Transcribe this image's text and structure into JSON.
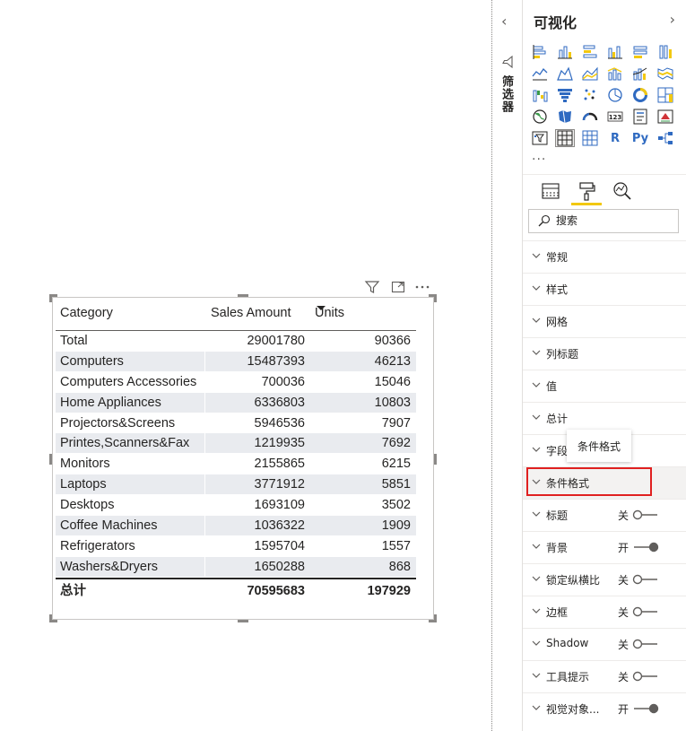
{
  "table": {
    "headers": [
      "Category",
      "Sales Amount",
      "Units"
    ],
    "rows": [
      {
        "category": "Total",
        "sales": "29001780",
        "units": "90366"
      },
      {
        "category": "Computers",
        "sales": "15487393",
        "units": "46213"
      },
      {
        "category": "Computers Accessories",
        "sales": "700036",
        "units": "15046"
      },
      {
        "category": "Home Appliances",
        "sales": "6336803",
        "units": "10803"
      },
      {
        "category": "Projectors&Screens",
        "sales": "5946536",
        "units": "7907"
      },
      {
        "category": "Printes,Scanners&Fax",
        "sales": "1219935",
        "units": "7692"
      },
      {
        "category": "Monitors",
        "sales": "2155865",
        "units": "6215"
      },
      {
        "category": "Laptops",
        "sales": "3771912",
        "units": "5851"
      },
      {
        "category": "Desktops",
        "sales": "1693109",
        "units": "3502"
      },
      {
        "category": "Coffee Machines",
        "sales": "1036322",
        "units": "1909"
      },
      {
        "category": "Refrigerators",
        "sales": "1595704",
        "units": "1557"
      },
      {
        "category": "Washers&Dryers",
        "sales": "1650288",
        "units": "868"
      }
    ],
    "total": {
      "category": "总计",
      "sales": "70595683",
      "units": "197929"
    },
    "sort_column": "Units",
    "sort_direction": "descending"
  },
  "visual_header_icons": [
    "filter-icon",
    "focus-mode-icon",
    "more-options-icon"
  ],
  "filter_pane": {
    "label": "筛选器",
    "collapse_icon": "chevron-left-icon"
  },
  "viz_pane": {
    "title": "可视化",
    "expand_icon": "chevron-right-icon",
    "more_label": "···",
    "visual_icons": [
      "stacked-bar-chart",
      "stacked-column-chart",
      "clustered-bar-chart",
      "clustered-column-chart",
      "100-stacked-bar-chart",
      "100-stacked-column-chart",
      "line-chart",
      "area-chart",
      "stacked-area-chart",
      "line-clustered-column-chart",
      "line-stacked-column-chart",
      "ribbon-chart",
      "waterfall-chart",
      "funnel-chart",
      "scatter-chart",
      "pie-chart",
      "donut-chart",
      "treemap",
      "map",
      "filled-map",
      "gauge",
      "card",
      "multi-row-card",
      "kpi",
      "slicer",
      "table",
      "matrix",
      "r-script-visual",
      "python-visual",
      "decomposition-tree"
    ],
    "selected_visual": "table",
    "text_icons": {
      "r-script-visual": "R",
      "python-visual": "Py",
      "card": "123"
    },
    "tabs": [
      "fields-tab",
      "format-tab",
      "analytics-tab"
    ],
    "active_tab": "format-tab",
    "search_placeholder": "搜索",
    "sections": [
      {
        "label": "常规"
      },
      {
        "label": "样式"
      },
      {
        "label": "网格"
      },
      {
        "label": "列标题"
      },
      {
        "label": "值"
      },
      {
        "label": "总计"
      },
      {
        "label": "字段"
      },
      {
        "label": "条件格式"
      },
      {
        "label": "标题",
        "toggle": "关",
        "on": false
      },
      {
        "label": "背景",
        "toggle": "开",
        "on": true
      },
      {
        "label": "锁定纵横比",
        "toggle": "关",
        "on": false
      },
      {
        "label": "边框",
        "toggle": "关",
        "on": false
      },
      {
        "label": "Shadow",
        "toggle": "关",
        "on": false
      },
      {
        "label": "工具提示",
        "toggle": "关",
        "on": false
      },
      {
        "label": "视觉对象...",
        "toggle": "开",
        "on": true
      }
    ],
    "tooltip": "条件格式"
  },
  "colors": {
    "accent_yellow": "#f2c811",
    "icon_blue": "#2f6ac1",
    "highlight_red": "#e02020",
    "row_band": "#e9ebef"
  }
}
